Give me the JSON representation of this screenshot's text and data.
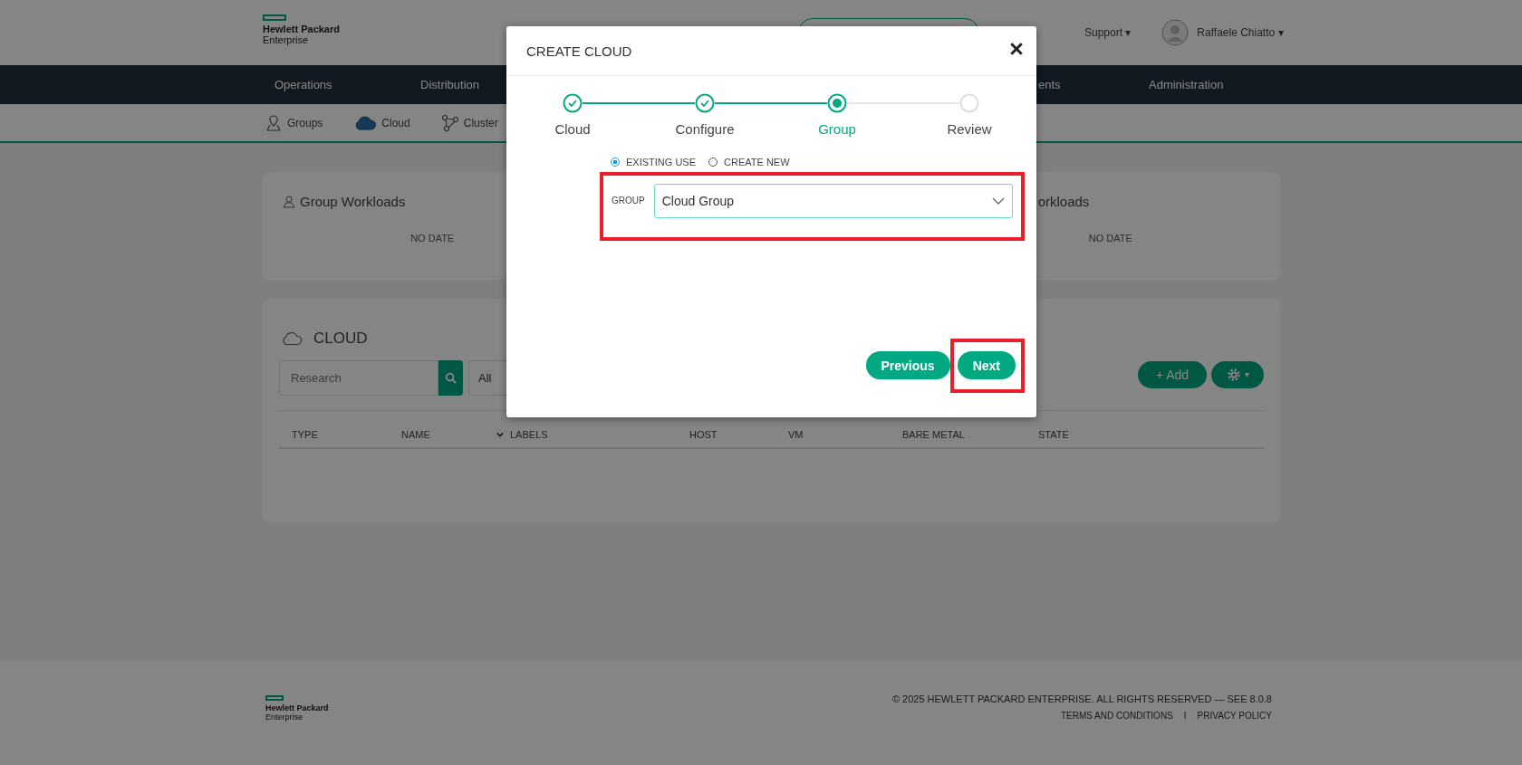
{
  "header": {
    "logo": {
      "line1": "Hewlett Packard",
      "line2": "Enterprise"
    },
    "support": "Support",
    "user": "Raffaele Chiatto",
    "caret": "▾"
  },
  "nav": {
    "left": [
      "Operations",
      "Distribution"
    ],
    "right": [
      "ents",
      "Administration"
    ]
  },
  "subnav": [
    {
      "label": "Groups",
      "selected": false
    },
    {
      "label": "Cloud",
      "selected": true
    },
    {
      "label": "Cluster",
      "selected": false
    }
  ],
  "workloads": {
    "left": {
      "title": "Group Workloads",
      "empty": "NO DATE"
    },
    "right": {
      "title": "orkloads",
      "empty": "NO DATE"
    }
  },
  "cloud": {
    "title": "CLOUD",
    "search": {
      "placeholder": "Research"
    },
    "filter": "All",
    "add": "+ Add",
    "settings_caret": "▾",
    "columns": [
      {
        "label": "TYPE",
        "sorted": false
      },
      {
        "label": "NAME",
        "sorted": false
      },
      {
        "label": "LABELS",
        "sorted": true
      },
      {
        "label": "HOST",
        "sorted": false
      },
      {
        "label": "VM",
        "sorted": false
      },
      {
        "label": "BARE METAL",
        "sorted": false
      },
      {
        "label": "STATE",
        "sorted": false
      }
    ]
  },
  "footer": {
    "logo": {
      "line1": "Hewlett Packard",
      "line2": "Enterprise"
    },
    "copyright": "© 2025 HEWLETT PACKARD ENTERPRISE. ALL RIGHTS RESERVED — SEE 8.0.8",
    "links": [
      "TERMS AND CONDITIONS",
      "PRIVACY POLICY"
    ],
    "separator": "I"
  },
  "modal": {
    "title": "CREATE CLOUD",
    "steps": [
      {
        "label": "Cloud",
        "completed": true,
        "selected": false
      },
      {
        "label": "Configure",
        "completed": true,
        "selected": false
      },
      {
        "label": "Group",
        "completed": false,
        "selected": true
      },
      {
        "label": "Review",
        "completed": false,
        "selected": false
      }
    ],
    "options": [
      {
        "label": "EXISTING USE",
        "selected": true
      },
      {
        "label": "CREATE NEW",
        "selected": false
      }
    ],
    "group": {
      "label": "GROUP",
      "value": "Cloud Group",
      "highlighted": true
    },
    "previous": {
      "label": "Previous",
      "highlighted": false
    },
    "next": {
      "label": "Next",
      "highlighted": true
    }
  }
}
